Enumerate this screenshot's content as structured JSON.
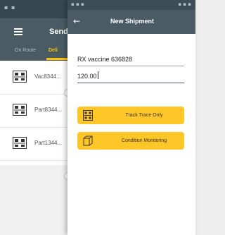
{
  "background_screen": {
    "title": "Sende",
    "tabs": [
      {
        "label": "On Route"
      },
      {
        "label": "Deli"
      }
    ],
    "list_items": [
      {
        "label": "Vac8344...",
        "icon": "package-sensor-icon"
      },
      {
        "label": "Part8344...",
        "icon": "package-sensor-icon"
      },
      {
        "label": "Part1344...",
        "icon": "package-sensor-icon"
      }
    ]
  },
  "dialog": {
    "title": "New Shipment",
    "back_icon": "arrow-left-icon",
    "fields": {
      "name_value": "RX vaccine 636828",
      "number_value": "120.00"
    },
    "buttons": {
      "track_trace": {
        "label": "Track Trace Only",
        "icon": "package-sensor-icon"
      },
      "condition_monitoring": {
        "label": "Condition Monitoring",
        "icon": "box-icon"
      }
    }
  },
  "colors": {
    "header": "#4a5b64",
    "status_bar": "#37474f",
    "accent": "#ffc627",
    "active_tab": "#ffc107"
  }
}
